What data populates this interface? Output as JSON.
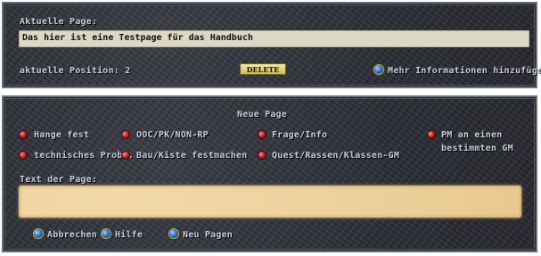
{
  "top": {
    "page_label": "Aktuelle Page:",
    "page_value": "Das hier ist eine Testpage für das Handbuch",
    "position_label": "aktuelle Position: 2",
    "delete_label": "DELETE",
    "more_info_label": "Mehr Informationen hinzufügen"
  },
  "new_page": {
    "title": "Neue Page",
    "options": {
      "hange_fest": "Hange fest",
      "ooc": "OOC/PK/NON-RP",
      "frage": "Frage/Info",
      "pm_line1": "PM an einen",
      "pm_line2": "bestimmten GM",
      "technisch": "technisches Probl.",
      "bau": "Bau/Kiste festmachen",
      "quest": "Quest/Rassen/Klassen-GM"
    },
    "text_label": "Text der Page:",
    "text_value": "",
    "actions": {
      "cancel": "Abbrechen",
      "help": "Hilfe",
      "new_pages": "Neu Pagen"
    }
  },
  "colors": {
    "panel_bg": "#2f323a",
    "label_text": "#c8cedd",
    "field_bg": "#dcd8c4",
    "paper_bg": "#efd3a0",
    "delete_bg": "#e6d874",
    "bullet": "#c41212",
    "globe": "#2e6fd0"
  },
  "icons": {
    "globe": "globe-icon",
    "bullet": "red-gem-icon"
  }
}
